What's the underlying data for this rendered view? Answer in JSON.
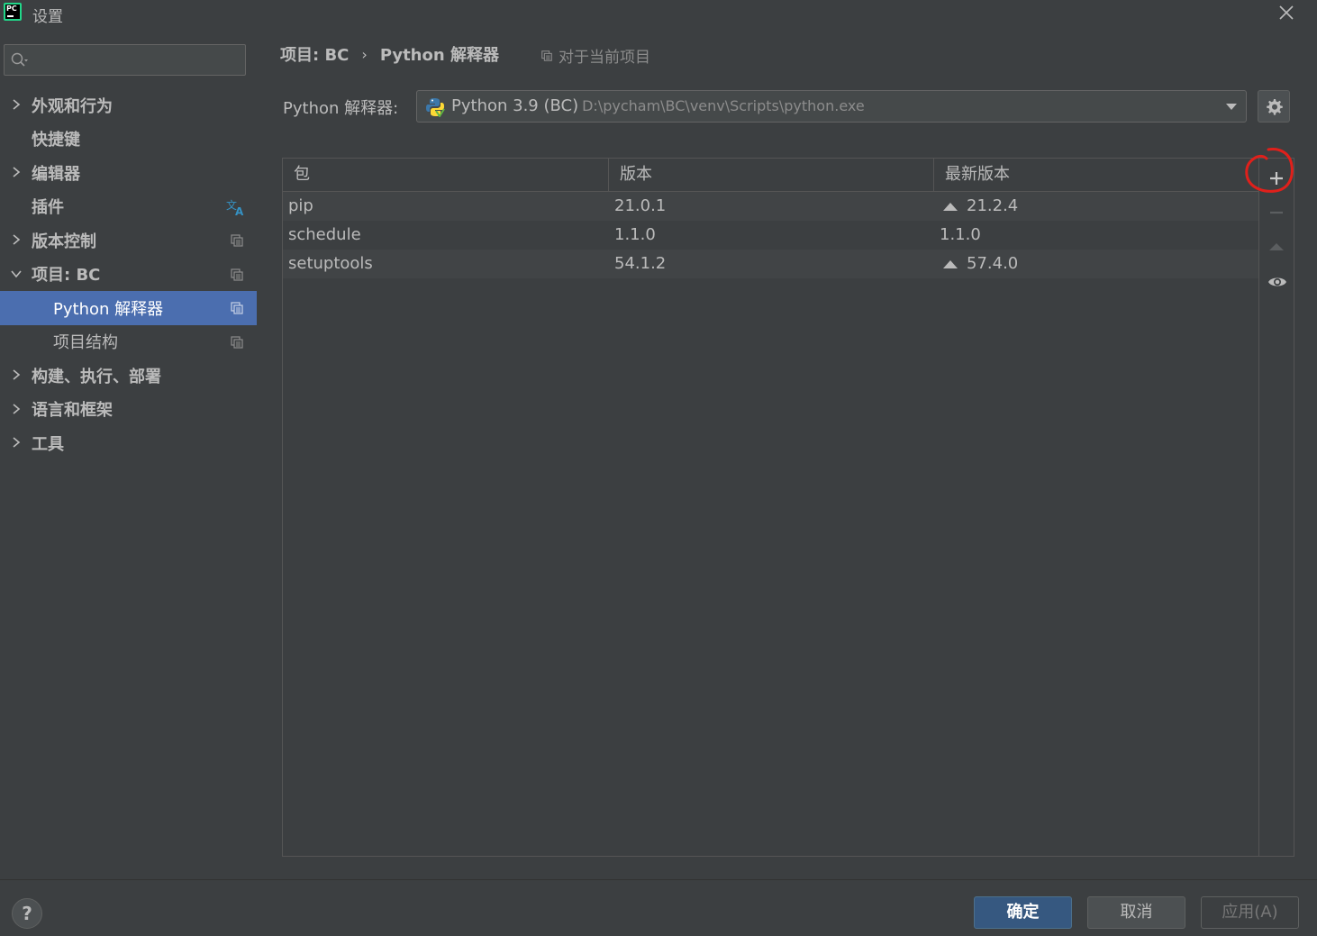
{
  "window": {
    "title": "设置",
    "logo_text": "PC"
  },
  "sidebar": {
    "search": {
      "placeholder": "",
      "value": ""
    },
    "items": [
      {
        "label": "外观和行为",
        "expandable": true,
        "expanded": false
      },
      {
        "label": "快捷键",
        "expandable": false
      },
      {
        "label": "编辑器",
        "expandable": true,
        "expanded": false
      },
      {
        "label": "插件",
        "expandable": false,
        "icon": "translate-icon"
      },
      {
        "label": "版本控制",
        "expandable": true,
        "expanded": false,
        "icon": "project-scope-icon"
      },
      {
        "label": "项目: BC",
        "expandable": true,
        "expanded": true,
        "icon": "project-scope-icon"
      },
      {
        "label": "Python 解释器",
        "sub": true,
        "selected": true,
        "icon": "project-scope-icon"
      },
      {
        "label": "项目结构",
        "sub": true,
        "icon": "project-scope-icon"
      },
      {
        "label": "构建、执行、部署",
        "expandable": true,
        "expanded": false
      },
      {
        "label": "语言和框架",
        "expandable": true,
        "expanded": false
      },
      {
        "label": "工具",
        "expandable": true,
        "expanded": false
      }
    ]
  },
  "breadcrumb": {
    "project": "项目: BC",
    "separator": "›",
    "page": "Python 解释器",
    "scope_note": "对于当前项目"
  },
  "interpreter": {
    "label": "Python 解释器:",
    "selected_name": "Python 3.9 (BC)",
    "selected_path": "D:\\pycham\\BC\\venv\\Scripts\\python.exe"
  },
  "packages_table": {
    "columns": [
      "包",
      "版本",
      "最新版本"
    ],
    "rows": [
      {
        "package": "pip",
        "version": "21.0.1",
        "latest": "21.2.4",
        "upgrade_available": true
      },
      {
        "package": "schedule",
        "version": "1.1.0",
        "latest": "1.1.0",
        "upgrade_available": false
      },
      {
        "package": "setuptools",
        "version": "54.1.2",
        "latest": "57.4.0",
        "upgrade_available": true
      }
    ]
  },
  "footer": {
    "help": "?",
    "ok": "确定",
    "cancel": "取消",
    "apply": "应用(A)"
  },
  "colors": {
    "background": "#3c3f41",
    "selection": "#4b6eaf",
    "ok_button": "#365880",
    "annotation_circle": "#e0201b"
  }
}
